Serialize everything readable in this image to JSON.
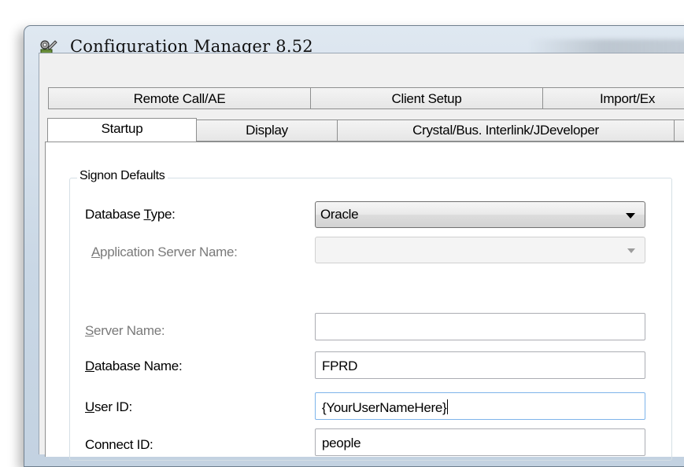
{
  "window": {
    "title": "Configuration Manager 8.52",
    "icon": "gear-wrench-icon"
  },
  "tabs": {
    "row_back": [
      "Remote Call/AE",
      "Client Setup",
      "Import/Ex"
    ],
    "row_front": [
      "Startup",
      "Display",
      "Crystal/Bus. Interlink/JDeveloper"
    ],
    "active": "Startup"
  },
  "signon": {
    "group_label": "Signon Defaults",
    "database_type": {
      "label_pre": "Database ",
      "label_key": "T",
      "label_post": "ype:",
      "value": "Oracle"
    },
    "app_server_name": {
      "label_pre": "",
      "label_key": "A",
      "label_post": "pplication Server Name:",
      "value": ""
    },
    "server_name": {
      "label_pre": "",
      "label_key": "S",
      "label_post": "erver Name:",
      "value": ""
    },
    "database_name": {
      "label_pre": "",
      "label_key": "D",
      "label_post": "atabase Name:",
      "value": "FPRD"
    },
    "user_id": {
      "label_pre": "",
      "label_key": "U",
      "label_post": "ser ID:",
      "value": "{YourUserNameHere}"
    },
    "connect_id": {
      "label": "Connect ID:",
      "value": "people"
    }
  },
  "colors": {
    "title_bar": "#c9d7e5",
    "focus_border": "#7eb4ea",
    "disabled_text": "#7a7a7a"
  }
}
